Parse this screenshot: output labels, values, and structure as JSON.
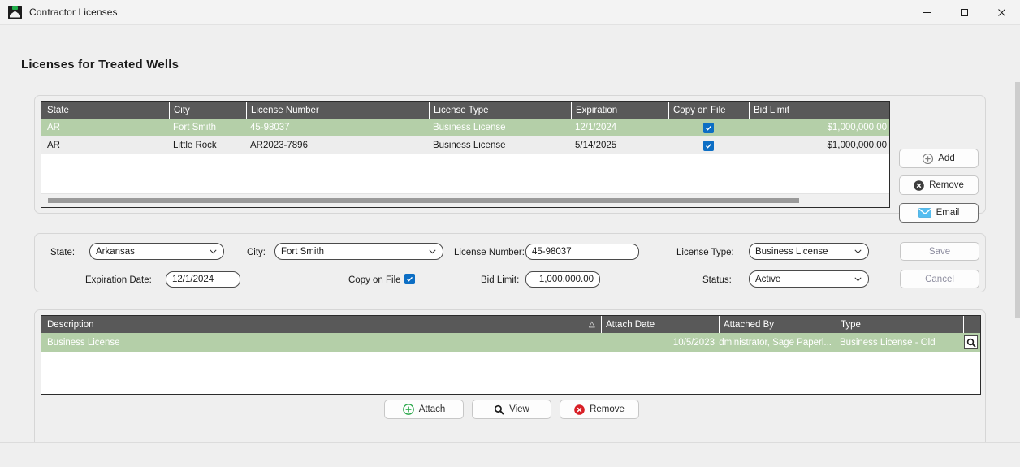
{
  "window": {
    "title": "Contractor Licenses",
    "icon": "sage-app-icon",
    "controls": {
      "minimize": "minimize-icon",
      "maximize": "maximize-icon",
      "close": "close-icon"
    }
  },
  "page": {
    "title": "Licenses for Treated Wells"
  },
  "licenses_grid": {
    "columns": [
      "State",
      "City",
      "License Number",
      "License Type",
      "Expiration",
      "Copy on File",
      "Bid Limit"
    ],
    "rows": [
      {
        "state": "AR",
        "city": "Fort Smith",
        "license_number": "45-98037",
        "license_type": "Business License",
        "expiration": "12/1/2024",
        "copy_on_file": true,
        "bid_limit": "$1,000,000.00",
        "selected": true
      },
      {
        "state": "AR",
        "city": "Little Rock",
        "license_number": "AR2023-7896",
        "license_type": "Business License",
        "expiration": "5/14/2025",
        "copy_on_file": true,
        "bid_limit": "$1,000,000.00",
        "selected": false
      }
    ]
  },
  "grid_actions": {
    "add": "Add",
    "remove": "Remove",
    "email": "Email"
  },
  "form": {
    "state_label": "State:",
    "state_value": "Arkansas",
    "city_label": "City:",
    "city_value": "Fort Smith",
    "license_number_label": "License Number:",
    "license_number_value": "45-98037",
    "license_type_label": "License Type:",
    "license_type_value": "Business License",
    "expiration_label": "Expiration Date:",
    "expiration_value": "12/1/2024",
    "copy_on_file_label": "Copy on File",
    "copy_on_file_checked": true,
    "bid_limit_label": "Bid Limit:",
    "bid_limit_value": "1,000,000.00",
    "status_label": "Status:",
    "status_value": "Active",
    "save": "Save",
    "cancel": "Cancel"
  },
  "attachments_grid": {
    "columns": [
      "Description",
      "Attach Date",
      "Attached By",
      "Type"
    ],
    "sort_indicator": "△",
    "rows": [
      {
        "description": "Business License",
        "attach_date": "10/5/2023",
        "attached_by": "Administrator, Sage Paperl...",
        "type": "Business License - Old",
        "selected": true
      }
    ]
  },
  "attachment_actions": {
    "attach": "Attach",
    "view": "View",
    "remove": "Remove"
  },
  "colors": {
    "selection_green": "#b4cfa8",
    "header_gray": "#595959",
    "checkbox_blue": "#0c6ec4",
    "attach_green": "#2aa84a",
    "remove_red": "#d81f26",
    "email_blue": "#3aa8e0",
    "window_bg": "#efefef"
  }
}
